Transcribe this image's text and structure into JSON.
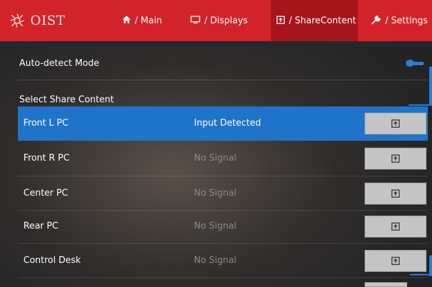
{
  "header": {
    "logo_text": "OIST",
    "nav": [
      {
        "label": "/ Main",
        "icon": "home-icon"
      },
      {
        "label": "/ Displays",
        "icon": "display-icon"
      },
      {
        "label": "/ ShareContent",
        "icon": "share-content-icon"
      },
      {
        "label": "/ Settings",
        "icon": "wrench-icon"
      }
    ],
    "active_tab": "/ ShareContent"
  },
  "auto_detect": {
    "label": "Auto-detect Mode",
    "enabled": true
  },
  "share": {
    "section_label": "Select Share Content",
    "sources": [
      {
        "name": "Front L PC",
        "status": "Input Detected",
        "selected": true
      },
      {
        "name": "Front R PC",
        "status": "No Signal",
        "selected": false
      },
      {
        "name": "Center PC",
        "status": "No Signal",
        "selected": false
      },
      {
        "name": "Rear PC",
        "status": "No Signal",
        "selected": false
      },
      {
        "name": "Control Desk",
        "status": "No Signal",
        "selected": false
      }
    ]
  },
  "colors": {
    "brand_red": "#d2232a",
    "active_tab": "#a5151b",
    "selection_blue": "#1f74c9",
    "toggle_blue": "#2a7fd4"
  }
}
